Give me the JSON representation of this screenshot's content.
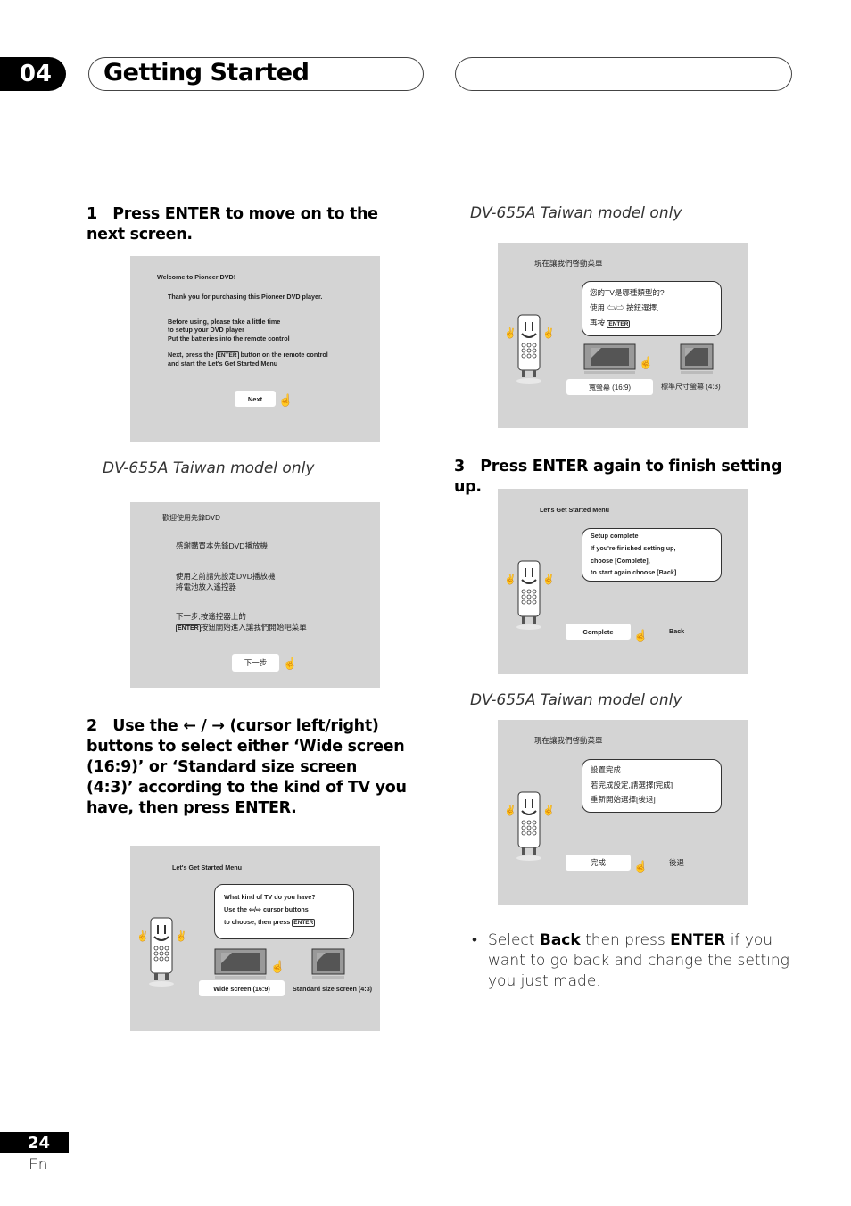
{
  "header": {
    "chapter_number": "04",
    "chapter_title": "Getting Started"
  },
  "steps": {
    "step1": {
      "number": "1",
      "text": "Press ENTER to move on to the next screen."
    },
    "step2": {
      "number": "2",
      "text_pre": "Use the",
      "arrows": "← / →",
      "text_post": "(cursor left/right) buttons to select either ‘Wide screen (16:9)’ or ‘Standard size screen (4:3)’ according to the kind of TV you have, then press ENTER."
    },
    "step3": {
      "number": "3",
      "text": "Press ENTER again to finish setting up."
    }
  },
  "model_labels": {
    "taiwan": "DV-655A Taiwan model only"
  },
  "screens": {
    "welcome_en": {
      "title": "Welcome to Pioneer DVD!",
      "line1": "Thank you for purchasing this Pioneer DVD player.",
      "line2": "Before using, please take a little time",
      "line3": "to setup your DVD player",
      "line4": "Put the batteries into the remote control",
      "line5_pre": "Next, press the",
      "enter": "ENTER",
      "line5_post": "button on the remote control",
      "line6": "and start the Let's Get Started Menu",
      "button": "Next"
    },
    "welcome_zh": {
      "title": "歡迎使用先鋒DVD",
      "line1": "感謝購買本先鋒DVD播放機",
      "line2": "使用之前請先設定DVD播放機",
      "line3": "將電池放入遙控器",
      "line4": "下一步,按遙控器上的",
      "enter": "ENTER",
      "line5": "按鈕開始進入讓我們開始吧菜單",
      "button": "下一步"
    },
    "tv_en": {
      "title": "Let's Get Started Menu",
      "bubble1": "What kind of TV do you have?",
      "bubble2_pre": "Use the",
      "bubble2_arrows": "⇦/⇨",
      "bubble2_post": "cursor buttons",
      "bubble3_pre": "to choose, then press",
      "enter": "ENTER",
      "option_wide": "Wide screen (16:9)",
      "option_standard": "Standard size screen (4:3)"
    },
    "tv_zh": {
      "title": "現在讓我們啓動菜單",
      "bubble1": "您的TV是哪種類型的?",
      "bubble2_pre": "使用",
      "bubble2_arrows": "⇦/⇨",
      "bubble2_post": "按鈕選擇,",
      "bubble3_pre": "再按",
      "enter": "ENTER",
      "option_wide": "寬螢幕 (16:9)",
      "option_standard": "標準尺寸螢幕 (4:3)"
    },
    "complete_en": {
      "title": "Let's Get Started Menu",
      "bubble1": "Setup complete",
      "bubble2": "If you're finished setting up,",
      "bubble3": "choose [Complete],",
      "bubble4": "to start again choose [Back]",
      "button_complete": "Complete",
      "button_back": "Back"
    },
    "complete_zh": {
      "title": "現在讓我們啓動菜單",
      "bubble1": "設置完成",
      "bubble2": "若完成設定,請選擇[完成]",
      "bubble3": "重新開始選擇[後退]",
      "button_complete": "完成",
      "button_back": "後退"
    }
  },
  "note": {
    "bullet": "•",
    "pre": "Select",
    "bold1": "Back",
    "mid": "then press",
    "bold2": "ENTER",
    "post": "if you want to go back and change the setting you just made."
  },
  "footer": {
    "page_number": "24",
    "language": "En"
  }
}
